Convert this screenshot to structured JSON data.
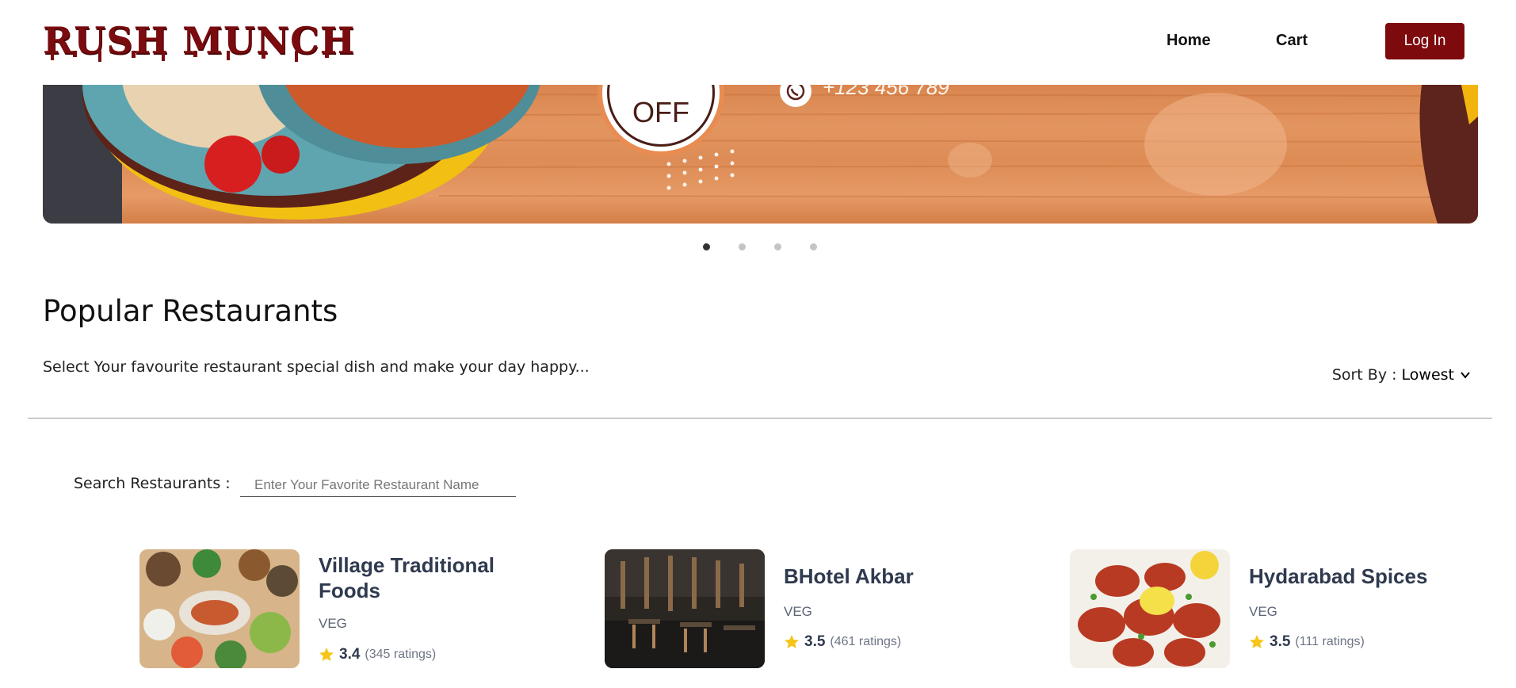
{
  "header": {
    "logo": "RUSH MUNCH",
    "nav": [
      {
        "label": "Home"
      },
      {
        "label": "Cart"
      }
    ],
    "login_label": "Log In",
    "brand_color": "#7d0a0d"
  },
  "banner": {
    "badge_text": "OFF",
    "phone": "+123 456 789",
    "phone_icon": "whatsapp-icon",
    "slides": 4,
    "active_slide": 1
  },
  "section": {
    "title": "Popular Restaurants",
    "subtitle": "Select Your favourite restaurant special dish and make your day happy...",
    "sort_label": "Sort By :",
    "sort_value": "Lowest"
  },
  "search": {
    "label": "Search Restaurants  :",
    "placeholder": "Enter Your Favorite Restaurant Name"
  },
  "restaurants": [
    {
      "name": "Village Traditional Foods",
      "type": "VEG",
      "rating": "3.4",
      "ratings_count": "(345 ratings)"
    },
    {
      "name": "BHotel Akbar",
      "type": "VEG",
      "rating": "3.5",
      "ratings_count": "(461 ratings)"
    },
    {
      "name": "Hydarabad Spices",
      "type": "VEG",
      "rating": "3.5",
      "ratings_count": "(111 ratings)"
    }
  ]
}
